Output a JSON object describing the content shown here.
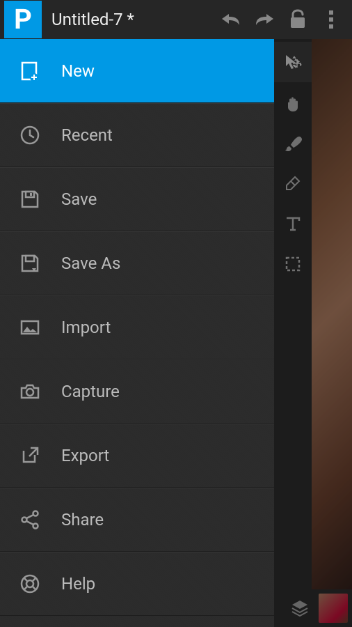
{
  "header": {
    "document_title": "Untitled-7 *",
    "logo_letter": "P"
  },
  "menu": {
    "items": [
      {
        "label": "New",
        "icon": "new-doc-icon",
        "active": true
      },
      {
        "label": "Recent",
        "icon": "clock-icon",
        "active": false
      },
      {
        "label": "Save",
        "icon": "save-icon",
        "active": false
      },
      {
        "label": "Save As",
        "icon": "save-as-icon",
        "active": false
      },
      {
        "label": "Import",
        "icon": "image-icon",
        "active": false
      },
      {
        "label": "Capture",
        "icon": "camera-icon",
        "active": false
      },
      {
        "label": "Export",
        "icon": "export-icon",
        "active": false
      },
      {
        "label": "Share",
        "icon": "share-icon",
        "active": false
      },
      {
        "label": "Help",
        "icon": "help-icon",
        "active": false
      }
    ]
  },
  "tools": [
    {
      "name": "move-tool",
      "active": true
    },
    {
      "name": "hand-tool",
      "active": false
    },
    {
      "name": "brush-tool",
      "active": false
    },
    {
      "name": "eraser-tool",
      "active": false
    },
    {
      "name": "text-tool",
      "active": false
    },
    {
      "name": "marquee-tool",
      "active": false
    }
  ]
}
